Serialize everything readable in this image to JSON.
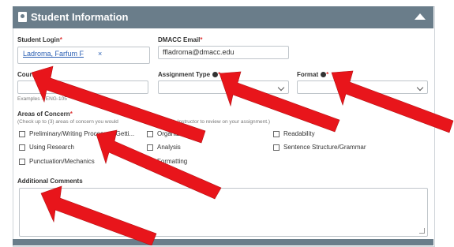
{
  "panel": {
    "title": "Student Information"
  },
  "fields": {
    "student_login": {
      "label": "Student Login",
      "required": "*",
      "value": "Ladroma, Farfum F",
      "remove": "×"
    },
    "email": {
      "label": "DMACC Email",
      "required": "*",
      "value": "ffladroma@dmacc.edu"
    },
    "course": {
      "label": "Course",
      "required": "*",
      "value": "",
      "hint": "Examples – ENG-105"
    },
    "assignment_type": {
      "label": "Assignment Type",
      "required": "*",
      "value": ""
    },
    "format": {
      "label": "Format",
      "required": "*",
      "value": ""
    }
  },
  "concerns": {
    "label": "Areas of Concern",
    "required": "*",
    "hint": "(Check up to (3) areas of concern you would",
    "hint2": "Lab Instructor to review on your assignment.)",
    "options": [
      "Preliminary/Writing Process or Getti...",
      "Organization",
      "Readability",
      "Using Research",
      "Analysis",
      "Sentence Structure/Grammar",
      "Punctuation/Mechanics",
      "Formatting"
    ]
  },
  "comments": {
    "label": "Additional Comments",
    "value": ""
  },
  "colors": {
    "header": "#6a7d8a",
    "arrow": "#e8151b",
    "link": "#2a5fb3",
    "required": "#d33333"
  }
}
